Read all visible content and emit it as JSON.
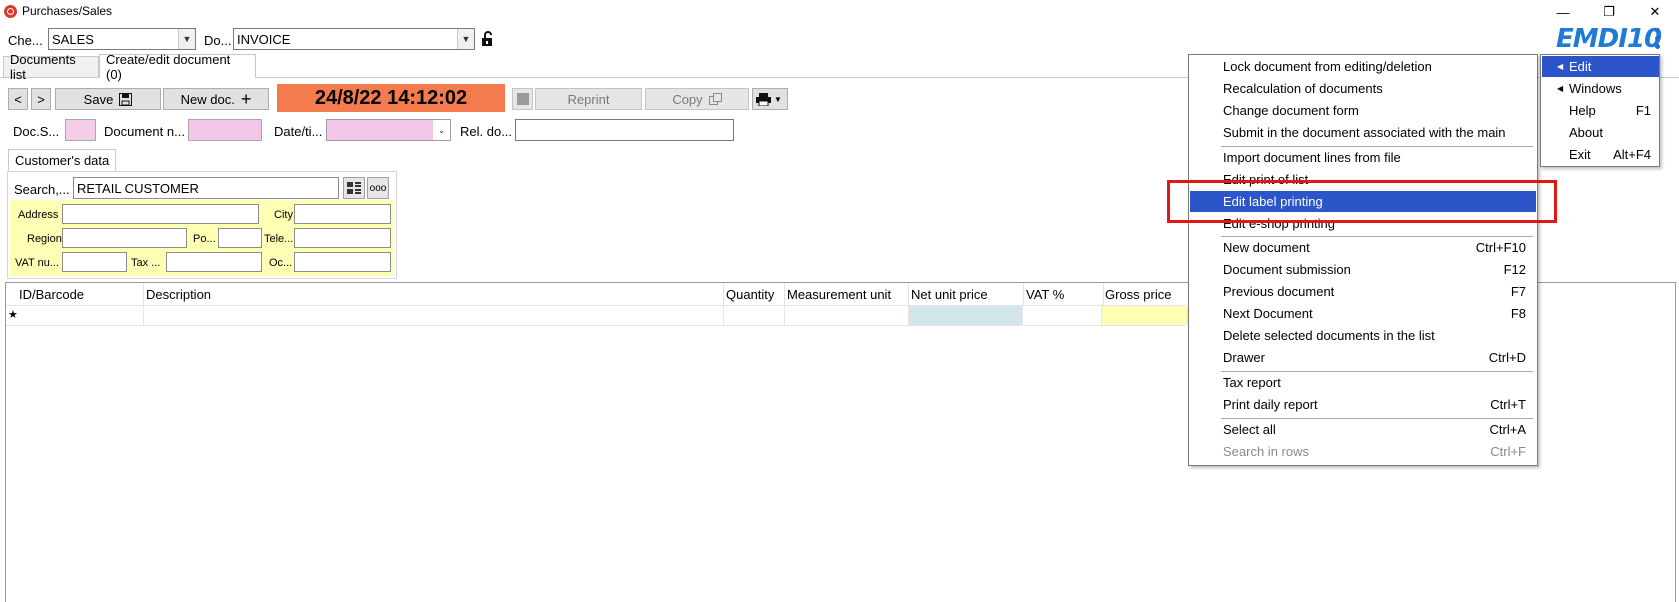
{
  "window": {
    "title": "Purchases/Sales",
    "minimize": "—",
    "restore": "❐",
    "close": "✕"
  },
  "top": {
    "check_label": "Che...",
    "check_value": "SALES",
    "doc_label": "Do...",
    "doc_value": "INVOICE"
  },
  "logo": "EMDI10",
  "tabs": [
    {
      "label": "Documents list"
    },
    {
      "label": "Create/edit document (0)"
    }
  ],
  "toolbar": {
    "prev": "<",
    "next": ">",
    "save_label": "Save",
    "new_doc_label": "New doc.",
    "datetime": "24/8/22 14:12:02",
    "reprint_label": "Reprint",
    "copy_label": "Copy"
  },
  "doc_row": {
    "series_label": "Doc.S...",
    "number_label": "Document n...",
    "date_label": "Date/ti...",
    "rel_label": "Rel. do..."
  },
  "customer": {
    "tab_label": "Customer's data",
    "search_label": "Search,...",
    "search_value": "RETAIL CUSTOMER",
    "address_label": "Address",
    "city_label": "City",
    "region_label": "Region",
    "po_label": "Po...",
    "tele_label": "Tele...",
    "vat_label": "VAT nu...",
    "tax_label": "Tax ...",
    "oc_label": "Oc..."
  },
  "grid": {
    "columns": [
      "ID/Barcode",
      "Description",
      "Quantity",
      "Measurement unit",
      "Net unit price",
      "VAT %",
      "Gross price"
    ],
    "new_row_marker": "★"
  },
  "context_menu": {
    "groups": [
      [
        {
          "label": "Lock document from editing/deletion",
          "shortcut": ""
        },
        {
          "label": "Recalculation of documents",
          "shortcut": ""
        },
        {
          "label": "Change document form",
          "shortcut": ""
        },
        {
          "label": "Submit in the document associated with the main",
          "shortcut": ""
        }
      ],
      [
        {
          "label": "Import document lines from file",
          "shortcut": ""
        },
        {
          "label": "Edit print of list",
          "shortcut": ""
        },
        {
          "label": "Edit label printing",
          "shortcut": "",
          "highlighted": true
        },
        {
          "label": "Edit e-shop printing",
          "shortcut": ""
        }
      ],
      [
        {
          "label": "New document",
          "shortcut": "Ctrl+F10"
        },
        {
          "label": "Document submission",
          "shortcut": "F12"
        },
        {
          "label": "Previous document",
          "shortcut": "F7"
        },
        {
          "label": "Next Document",
          "shortcut": "F8"
        },
        {
          "label": "Delete selected documents in the list",
          "shortcut": ""
        },
        {
          "label": "Drawer",
          "shortcut": "Ctrl+D"
        }
      ],
      [
        {
          "label": "Tax report",
          "shortcut": ""
        },
        {
          "label": "Print daily report",
          "shortcut": "Ctrl+T"
        }
      ],
      [
        {
          "label": "Select all",
          "shortcut": "Ctrl+A"
        },
        {
          "label": "Search in rows",
          "shortcut": "Ctrl+F",
          "disabled": true
        }
      ]
    ]
  },
  "side_menu": [
    {
      "label": "Edit",
      "shortcut": "",
      "submenu": true,
      "highlighted": true
    },
    {
      "label": "Windows",
      "shortcut": "",
      "submenu": true
    },
    {
      "label": "Help",
      "shortcut": "F1"
    },
    {
      "label": "About",
      "shortcut": ""
    },
    {
      "label": "Exit",
      "shortcut": "Alt+F4"
    }
  ],
  "colors": {
    "accent": "#2c55c9",
    "date_bg": "#f47b4e",
    "highlight_box": "#e01818",
    "customer_bg": "#fefeb5"
  }
}
